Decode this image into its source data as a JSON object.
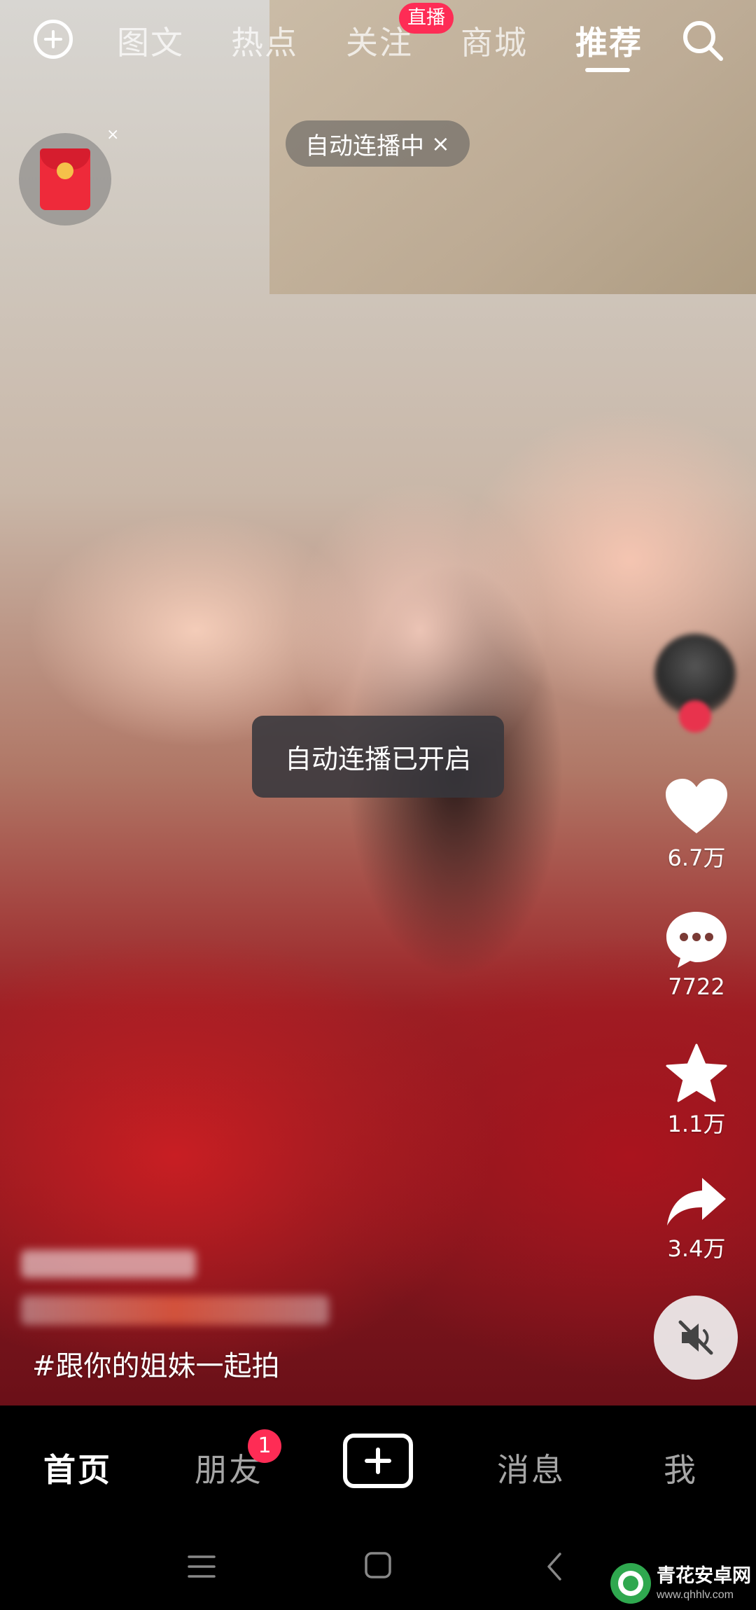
{
  "top_nav": {
    "tabs": [
      "图文",
      "热点",
      "关注",
      "商城",
      "推荐"
    ],
    "active_tab": "推荐",
    "live_badge": "直播",
    "icons": {
      "add": "add-circle-icon",
      "search": "search-icon"
    }
  },
  "red_packet": {
    "icon": "red-packet-icon",
    "close_glyph": "×"
  },
  "autoplay_pill": {
    "label": "自动连播中",
    "close_glyph": "×"
  },
  "toast": {
    "text": "自动连播已开启"
  },
  "sidebar": {
    "like_count": "6.7万",
    "comment_count": "7722",
    "favorite_count": "1.1万",
    "share_count": "3.4万",
    "icons": {
      "like": "heart-icon",
      "comment": "comment-bubble-icon",
      "favorite": "star-icon",
      "share": "share-arrow-icon",
      "mute": "speaker-muted-icon"
    }
  },
  "caption": {
    "hashtag": "#跟你的姐妹一起拍"
  },
  "bottom_nav": {
    "items": [
      "首页",
      "朋友",
      "消息",
      "我"
    ],
    "active": "首页",
    "friends_badge": "1",
    "publish_icon": "plus-square-icon"
  },
  "watermark": {
    "title": "青花安卓网",
    "url": "www.qhhlv.com"
  },
  "colors": {
    "accent": "#fe2c55",
    "background": "#000000"
  }
}
